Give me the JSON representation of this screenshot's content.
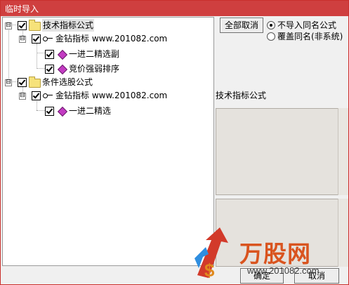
{
  "window": {
    "title": "临时导入"
  },
  "tree": {
    "groups": [
      {
        "label": "技术指标公式",
        "checked": true,
        "selected": true,
        "author": {
          "label": "金钻指标 www.201082.com",
          "checked": true
        },
        "items": [
          {
            "label": "一进二精选副",
            "checked": true
          },
          {
            "label": "竞价强弱排序",
            "checked": true
          }
        ]
      },
      {
        "label": "条件选股公式",
        "checked": true,
        "selected": false,
        "author": {
          "label": "金钻指标 www.201082.com",
          "checked": true
        },
        "items": [
          {
            "label": "一进二精选",
            "checked": true
          }
        ]
      }
    ],
    "expander_symbol": "⊟"
  },
  "options": {
    "cancel_all_label": "全部取消",
    "radios": [
      {
        "label": "不导入同名公式",
        "selected": true
      },
      {
        "label": "覆盖同名(非系统)",
        "selected": false
      }
    ]
  },
  "detail": {
    "section_label": "技术指标公式"
  },
  "footer": {
    "ok_label": "确定",
    "cancel_label": "取消"
  },
  "watermark": {
    "brand": "万股网",
    "url": "www.201082.com"
  },
  "colors": {
    "titlebar": "#cf3f3f",
    "watermark_orange": "#d9541f",
    "arrow_blue": "#2f8ee0",
    "arrow_red": "#d23a2a"
  }
}
